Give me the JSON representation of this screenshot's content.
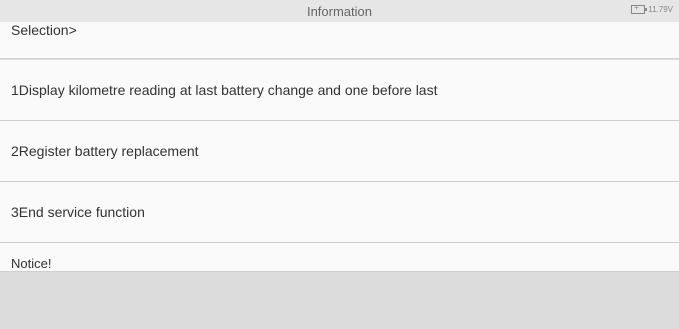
{
  "header": {
    "title": "Information",
    "battery_voltage": "11.79V"
  },
  "selection_label": "Selection>",
  "menu": {
    "items": [
      {
        "label": "1Display kilometre reading at last battery change and one before last"
      },
      {
        "label": "2Register battery replacement"
      },
      {
        "label": "3End service function"
      }
    ]
  },
  "notice_label": "Notice!",
  "colors": {
    "background": "#dcdcdc",
    "panel": "#fafafa",
    "divider": "#cfcfcf",
    "text": "#333333"
  }
}
